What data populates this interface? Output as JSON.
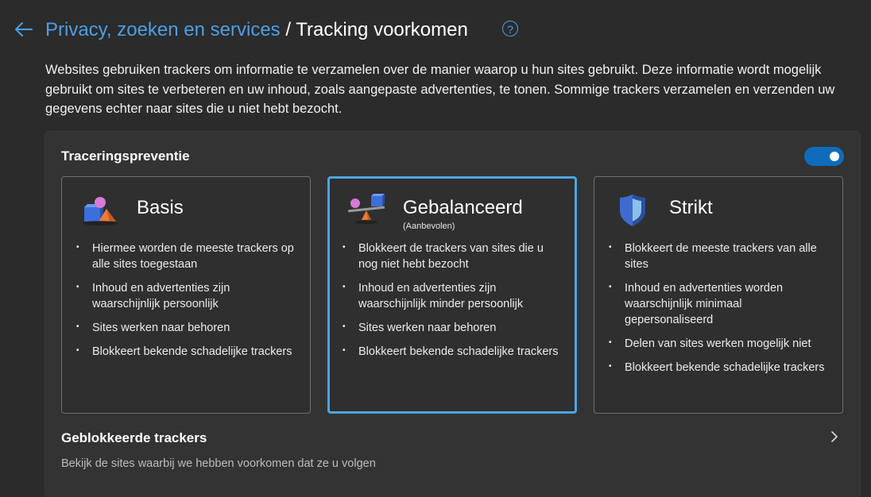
{
  "header": {
    "breadcrumb": "Privacy, zoeken en services",
    "separator": " / ",
    "title": "Tracking voorkomen"
  },
  "description": "Websites gebruiken trackers om informatie te verzamelen over de manier waarop u hun sites gebruikt. Deze informatie wordt mogelijk gebruikt om sites te verbeteren en uw inhoud, zoals aangepaste advertenties, te tonen. Sommige trackers verzamelen en verzenden uw gegevens echter naar sites die u niet hebt bezocht.",
  "prevention": {
    "label": "Traceringspreventie",
    "enabled": true
  },
  "cards": [
    {
      "name": "Basis",
      "subtitle": "",
      "icon": "shapes-icon",
      "selected": false,
      "bullets": [
        "Hiermee worden de meeste trackers op alle sites toegestaan",
        "Inhoud en advertenties zijn waarschijnlijk persoonlijk",
        "Sites werken naar behoren",
        "Blokkeert bekende schadelijke trackers"
      ]
    },
    {
      "name": "Gebalanceerd",
      "subtitle": "(Aanbevolen)",
      "icon": "balance-icon",
      "selected": true,
      "bullets": [
        "Blokkeert de trackers van sites die u nog niet hebt bezocht",
        "Inhoud en advertenties zijn waarschijnlijk minder persoonlijk",
        "Sites werken naar behoren",
        "Blokkeert bekende schadelijke trackers"
      ]
    },
    {
      "name": "Strikt",
      "subtitle": "",
      "icon": "shield-icon",
      "selected": false,
      "bullets": [
        "Blokkeert de meeste trackers van alle sites",
        "Inhoud en advertenties worden waarschijnlijk minimaal gepersonaliseerd",
        "Delen van sites werken mogelijk niet",
        "Blokkeert bekende schadelijke trackers"
      ]
    }
  ],
  "blocked": {
    "title": "Geblokkeerde trackers",
    "subtitle": "Bekijk de sites waarbij we hebben voorkomen dat ze u volgen"
  },
  "colors": {
    "accent": "#4c9fe6",
    "toggle": "#0f6cbd",
    "selected_border": "#4ba5e4",
    "background": "#2b2b2b"
  }
}
